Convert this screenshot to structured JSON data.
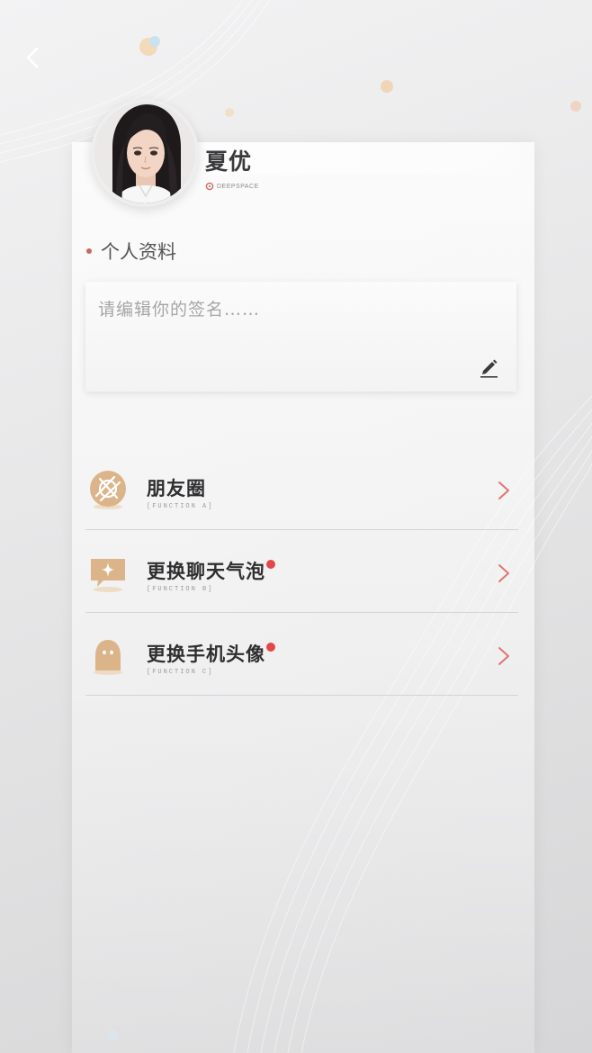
{
  "profile": {
    "name": "夏优",
    "brand": "DEEPSPACE"
  },
  "section": {
    "title": "个人资料"
  },
  "signature": {
    "placeholder": "请编辑你的签名……"
  },
  "menu": [
    {
      "label": "朋友圈",
      "sub": "[FUNCTION A]",
      "icon": "moments-icon",
      "badge": false
    },
    {
      "label": "更换聊天气泡",
      "sub": "[FUNCTION B]",
      "icon": "chat-bubble-icon",
      "badge": true
    },
    {
      "label": "更换手机头像",
      "sub": "[FUNCTION C]",
      "icon": "avatar-silhouette-icon",
      "badge": true
    }
  ],
  "colors": {
    "accent": "#c9685e",
    "badge": "#e4474b",
    "icon_gold": "#d9b384",
    "chevron": "#e07670"
  }
}
